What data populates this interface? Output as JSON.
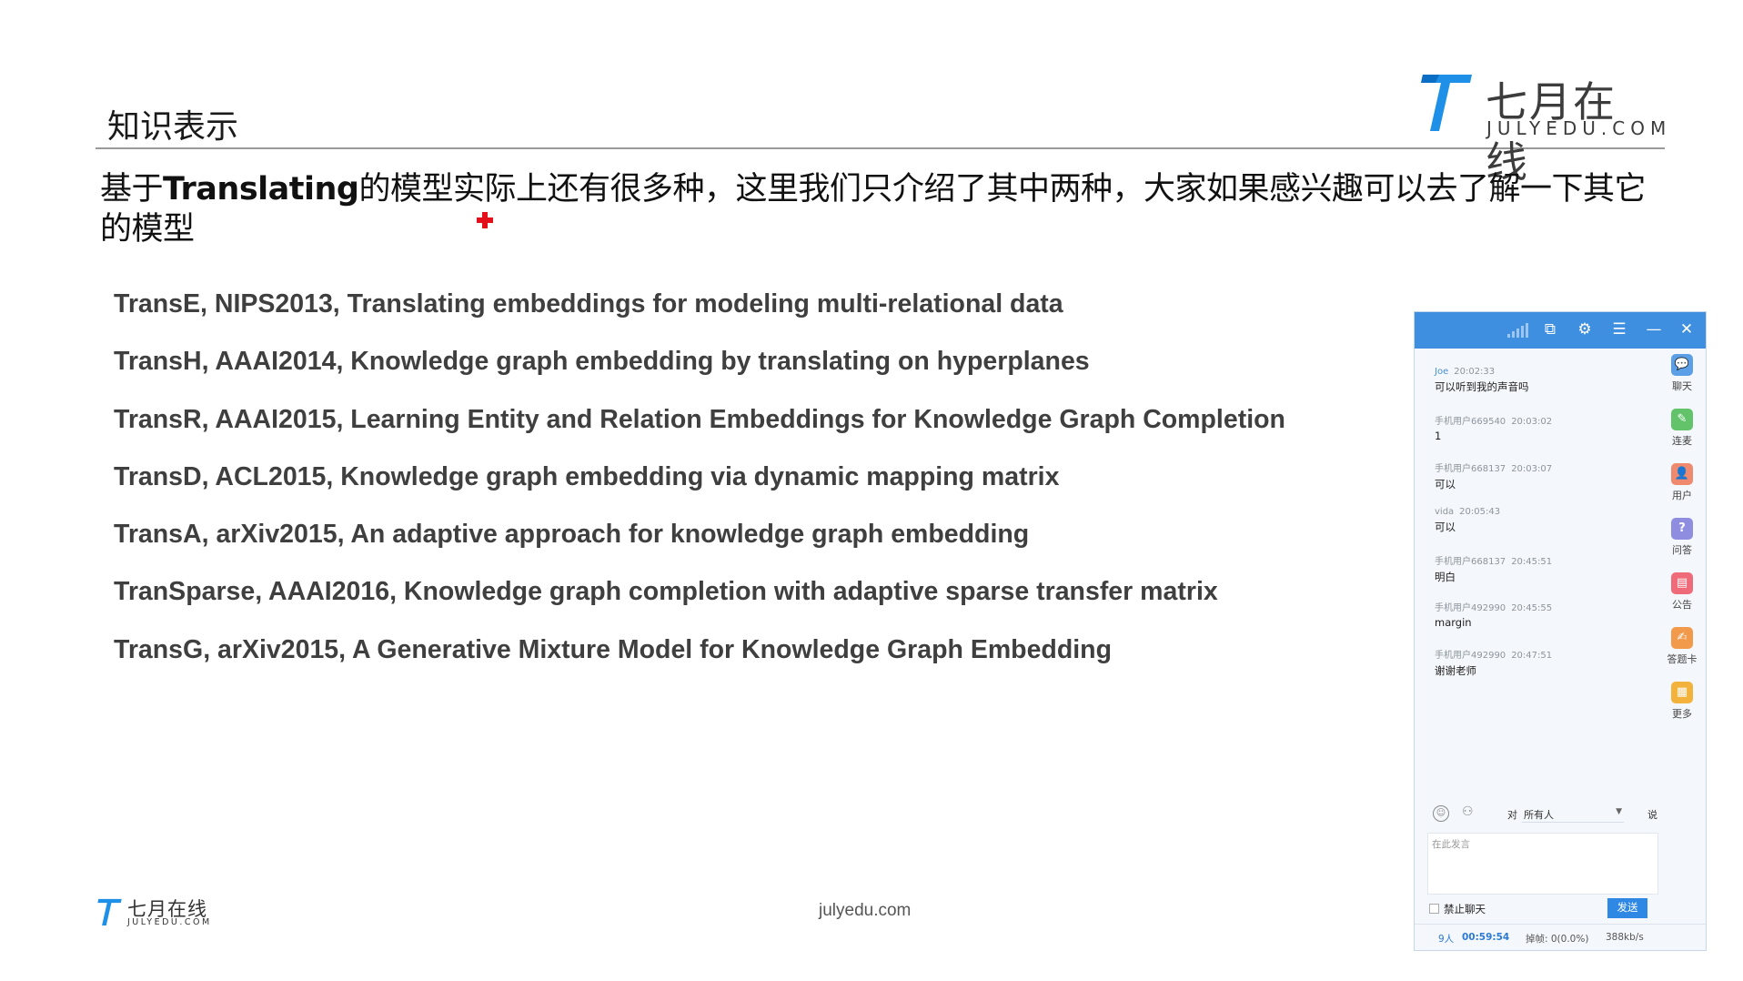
{
  "slide": {
    "title": "知识表示",
    "intro": {
      "prefix": "基于",
      "bold": "Translating",
      "suffix": "的模型实际上还有很多种，这里我们只介绍了其中两种，大家如果感兴趣可以去了解一下其它的模型"
    },
    "models": [
      "TransE, NIPS2013, Translating embeddings for modeling multi-relational data",
      "TransH, AAAI2014, Knowledge graph embedding by translating on hyperplanes",
      "TransR, AAAI2015, Learning Entity and Relation Embeddings for Knowledge Graph Completion",
      "TransD, ACL2015, Knowledge graph embedding via dynamic mapping matrix",
      "TransA, arXiv2015, An adaptive approach for knowledge graph embedding",
      "TranSparse, AAAI2016, Knowledge graph completion with adaptive sparse transfer matrix",
      "TransG, arXiv2015, A Generative Mixture Model for Knowledge Graph Embedding"
    ],
    "footer_url": "julyedu.com"
  },
  "brand": {
    "name_cn": "七月在线",
    "name_en": "JULYEDU.COM",
    "logo_color": "#1e90e8"
  },
  "chat": {
    "titlebar_icons": [
      "signal-icon",
      "popout-icon",
      "settings-icon",
      "menu-icon",
      "minimize-icon",
      "close-icon"
    ],
    "messages": [
      {
        "user": "Joe",
        "time": "20:02:33",
        "text": "可以听到我的声音吗"
      },
      {
        "user": "手机用户669540",
        "time": "20:03:02",
        "text": "1"
      },
      {
        "user": "手机用户668137",
        "time": "20:03:07",
        "text": "可以"
      },
      {
        "user": "vida",
        "time": "20:05:43",
        "text": "可以"
      },
      {
        "user": "手机用户668137",
        "time": "20:45:51",
        "text": "明白"
      },
      {
        "user": "手机用户492990",
        "time": "20:45:55",
        "text": "margin"
      },
      {
        "user": "手机用户492990",
        "time": "20:47:51",
        "text": "谢谢老师"
      }
    ],
    "tools": [
      {
        "label": "聊天",
        "icon": "chat-icon",
        "color": "#5b9fe6"
      },
      {
        "label": "连麦",
        "icon": "mic-link-icon",
        "color": "#62c36a"
      },
      {
        "label": "用户",
        "icon": "user-icon",
        "color": "#f08a6e"
      },
      {
        "label": "问答",
        "icon": "question-icon",
        "color": "#8e8de0"
      },
      {
        "label": "公告",
        "icon": "notice-icon",
        "color": "#f06b7a"
      },
      {
        "label": "答题卡",
        "icon": "answer-card-icon",
        "color": "#f29a4c"
      },
      {
        "label": "更多",
        "icon": "more-icon",
        "color": "#f3b23c"
      }
    ],
    "to_label": "对",
    "recipient": "所有人",
    "say_label": "说",
    "input_placeholder": "在此发言",
    "mute_label": "禁止聊天",
    "send_label": "发送",
    "status": {
      "online": "9人",
      "timer": "00:59:54",
      "drop": "掉帧: 0(0.0%)",
      "rate": "388kb/s"
    },
    "accent_color": "#3e8fe0"
  }
}
